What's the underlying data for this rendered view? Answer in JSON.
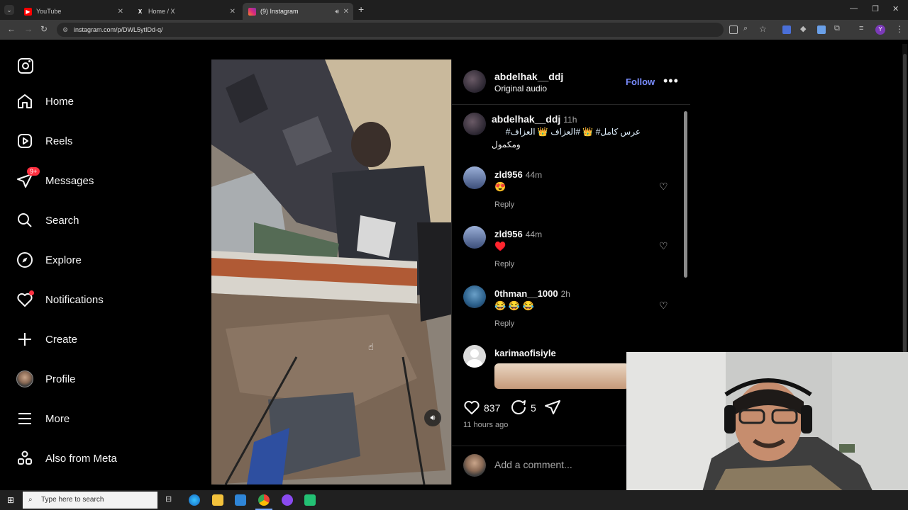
{
  "browser": {
    "tabs": [
      {
        "title": "YouTube",
        "color": "#ff0000"
      },
      {
        "title": "Home / X",
        "color": "#ffffff"
      },
      {
        "title": "(9) Instagram",
        "color": "#e1306c"
      }
    ],
    "new_tab": "+",
    "url": "instagram.com/p/DWL5ytIDd-q/"
  },
  "sidebar": {
    "items": [
      {
        "label": "Home",
        "icon": "home-icon"
      },
      {
        "label": "Reels",
        "icon": "reels-icon"
      },
      {
        "label": "Messages",
        "icon": "messages-icon",
        "badge": "9+"
      },
      {
        "label": "Search",
        "icon": "search-icon"
      },
      {
        "label": "Explore",
        "icon": "explore-icon"
      },
      {
        "label": "Notifications",
        "icon": "heart-icon"
      },
      {
        "label": "Create",
        "icon": "plus-icon"
      },
      {
        "label": "Profile",
        "icon": "avatar"
      },
      {
        "label": "More",
        "icon": "menu-icon"
      },
      {
        "label": "Also from Meta",
        "icon": "meta-icon"
      }
    ]
  },
  "post": {
    "author": "abdelhak__ddj",
    "audio": "Original audio",
    "follow": "Follow",
    "caption_user": "abdelhak__ddj",
    "caption_time": "11h",
    "caption_line1": "عرس كامل# 👑 #العزاف 👑 العزاف#",
    "caption_line2": "ومكمول",
    "comments": [
      {
        "user": "zld956",
        "time": "44m",
        "text": "😍",
        "reply": "Reply"
      },
      {
        "user": "zld956",
        "time": "44m",
        "text": "♥️",
        "reply": "Reply"
      },
      {
        "user": "0thman__1000",
        "time": "2h",
        "text": "😂 😂 😂",
        "reply": "Reply"
      },
      {
        "user": "karimaofisiyle",
        "time": "",
        "text": "",
        "reply": ""
      }
    ],
    "likes": "837",
    "comment_count": "5",
    "posted": "11 hours ago",
    "add_comment": "Add a comment..."
  },
  "taskbar": {
    "search_placeholder": "Type here to search"
  }
}
